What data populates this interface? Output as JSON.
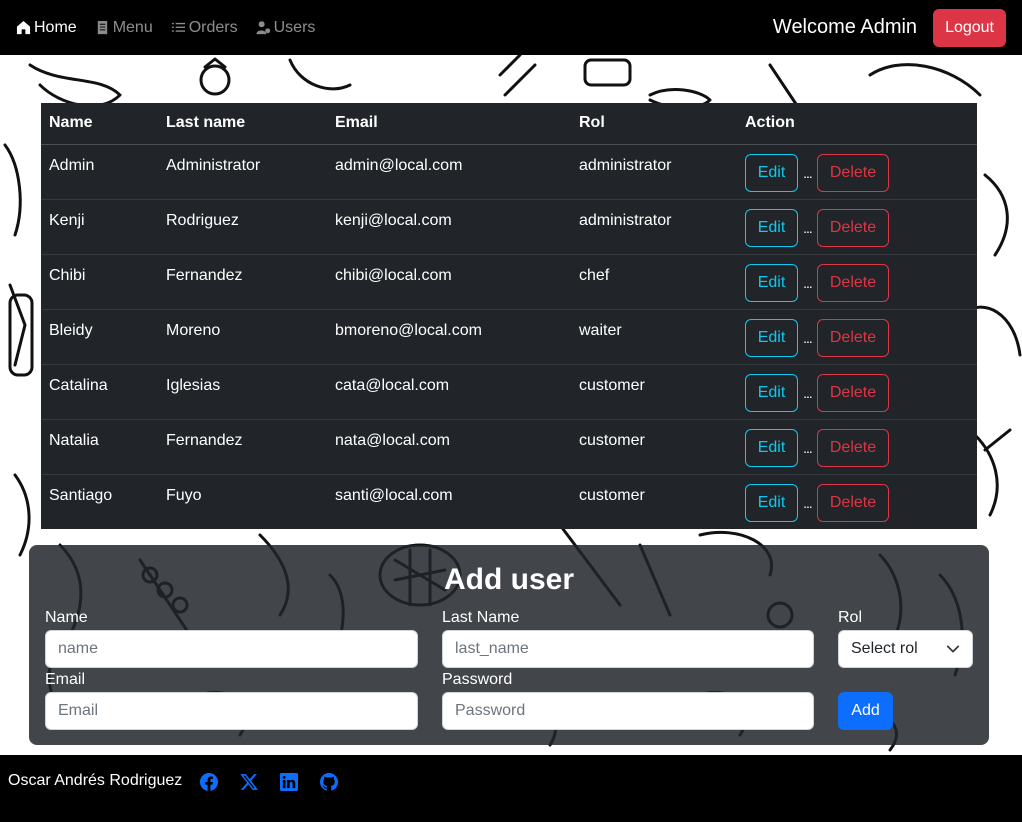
{
  "nav": {
    "links": [
      {
        "label": "Home",
        "icon": "house-icon"
      },
      {
        "label": "Menu",
        "icon": "journal-icon"
      },
      {
        "label": "Orders",
        "icon": "list-icon"
      },
      {
        "label": "Users",
        "icon": "person-gear-icon"
      }
    ],
    "welcome": "Welcome Admin",
    "logout_label": "Logout"
  },
  "table": {
    "headers": [
      "Name",
      "Last name",
      "Email",
      "Rol",
      "Action"
    ],
    "edit_label": "Edit",
    "delete_label": "Delete",
    "separator": "...",
    "rows": [
      {
        "name": "Admin",
        "last_name": "Administrator",
        "email": "admin@local.com",
        "rol": "administrator"
      },
      {
        "name": "Kenji",
        "last_name": "Rodriguez",
        "email": "kenji@local.com",
        "rol": "administrator"
      },
      {
        "name": "Chibi",
        "last_name": "Fernandez",
        "email": "chibi@local.com",
        "rol": "chef"
      },
      {
        "name": "Bleidy",
        "last_name": "Moreno",
        "email": "bmoreno@local.com",
        "rol": "waiter"
      },
      {
        "name": "Catalina",
        "last_name": "Iglesias",
        "email": "cata@local.com",
        "rol": "customer"
      },
      {
        "name": "Natalia",
        "last_name": "Fernandez",
        "email": "nata@local.com",
        "rol": "customer"
      },
      {
        "name": "Santiago",
        "last_name": "Fuyo",
        "email": "santi@local.com",
        "rol": "customer"
      }
    ]
  },
  "form": {
    "title": "Add user",
    "name_label": "Name",
    "name_placeholder": "name",
    "last_name_label": "Last Name",
    "last_name_placeholder": "last_name",
    "rol_label": "Rol",
    "rol_selected": "Select rol",
    "email_label": "Email",
    "email_placeholder": "Email",
    "password_label": "Password",
    "password_placeholder": "Password",
    "add_label": "Add"
  },
  "footer": {
    "author": "Oscar Andrés Rodriguez",
    "socials": [
      "facebook-icon",
      "x-icon",
      "linkedin-icon",
      "github-icon"
    ]
  },
  "colors": {
    "navbar": "#000000",
    "table_bg": "#212529",
    "danger": "#dc3545",
    "info": "#0dcaf0",
    "primary": "#0d6efd"
  }
}
